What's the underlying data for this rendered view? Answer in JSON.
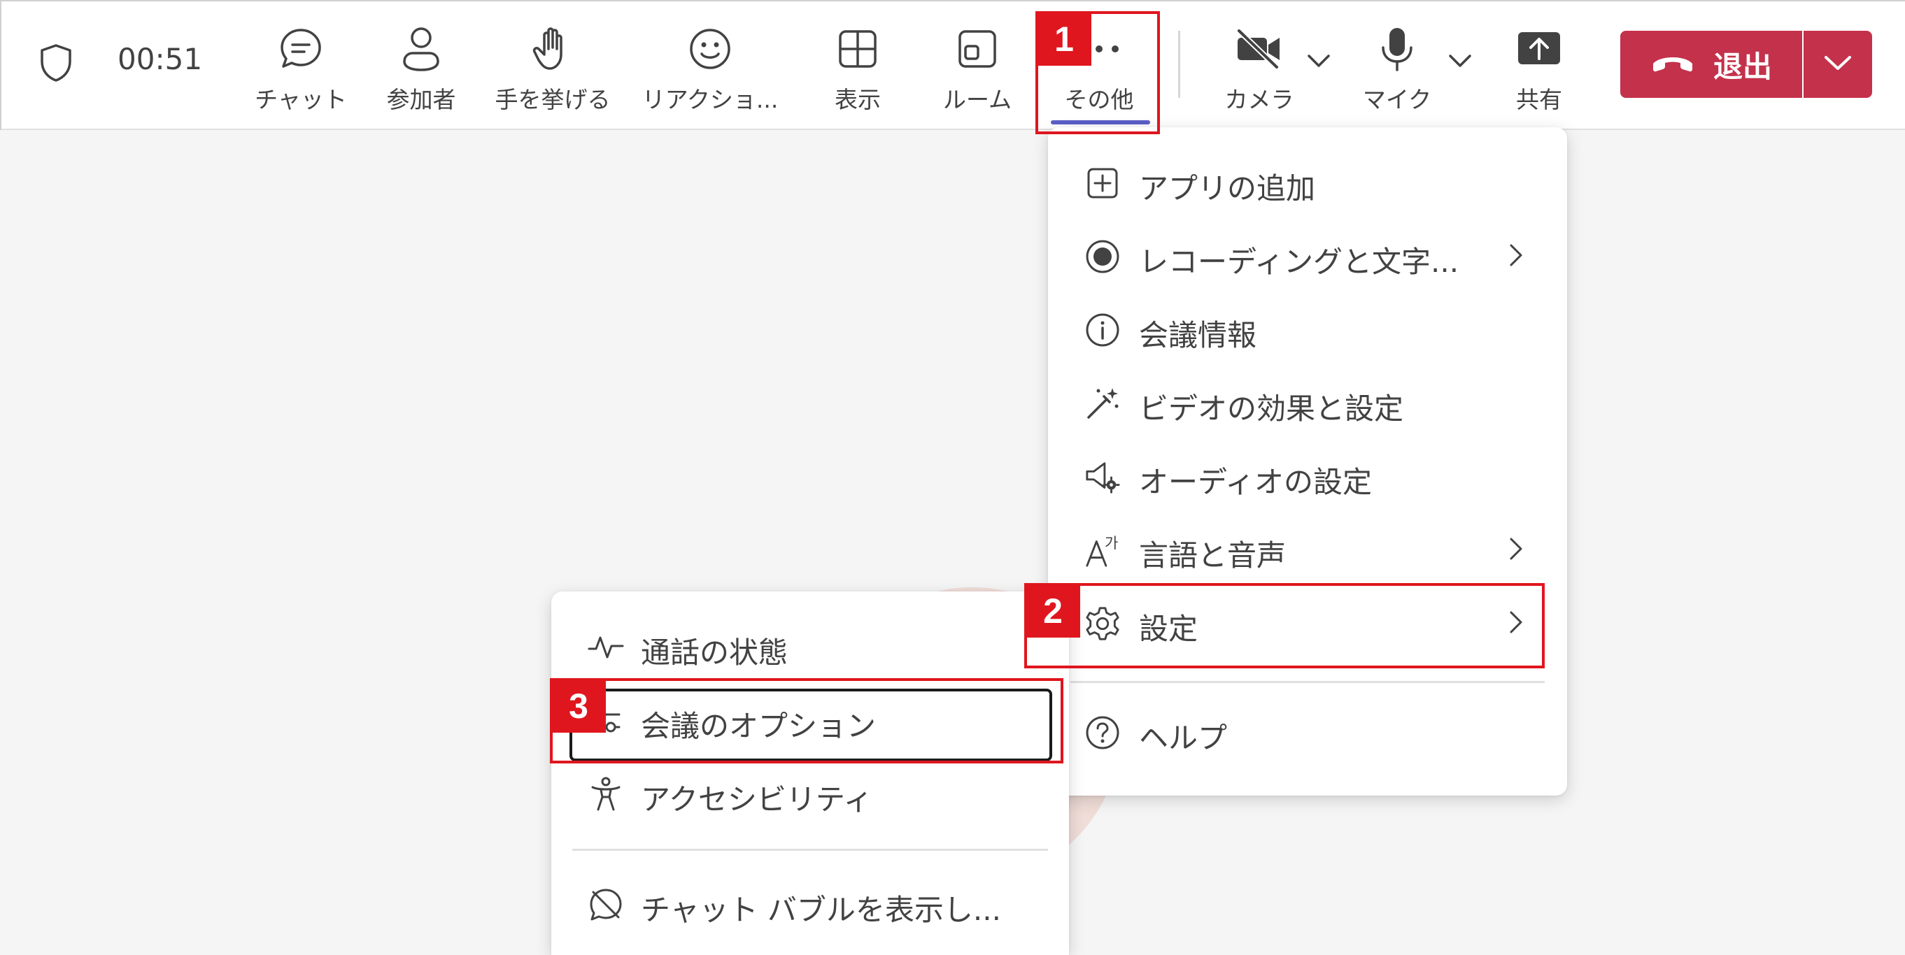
{
  "toolbar": {
    "timer": "00:51",
    "buttons": {
      "chat": "チャット",
      "participants": "参加者",
      "raise_hand": "手を挙げる",
      "reactions": "リアクショ...",
      "view": "表示",
      "rooms": "ルーム",
      "more": "その他",
      "camera": "カメラ",
      "mic": "マイク",
      "share": "共有"
    },
    "leave_label": "退出"
  },
  "more_menu": {
    "items": [
      {
        "label": "アプリの追加",
        "icon": "add-square-icon",
        "submenu": false
      },
      {
        "label": "レコーディングと文字...",
        "icon": "record-icon",
        "submenu": true
      },
      {
        "label": "会議情報",
        "icon": "info-icon",
        "submenu": false
      },
      {
        "label": "ビデオの効果と設定",
        "icon": "magic-wand-icon",
        "submenu": false
      },
      {
        "label": "オーディオの設定",
        "icon": "speaker-settings-icon",
        "submenu": false
      },
      {
        "label": "言語と音声",
        "icon": "language-icon",
        "submenu": true
      },
      {
        "label": "設定",
        "icon": "gear-icon",
        "submenu": true
      },
      {
        "label": "ヘルプ",
        "icon": "help-icon",
        "submenu": false
      }
    ]
  },
  "settings_submenu": {
    "items": [
      {
        "label": "通話の状態",
        "icon": "pulse-icon"
      },
      {
        "label": "会議のオプション",
        "icon": "options-icon"
      },
      {
        "label": "アクセシビリティ",
        "icon": "accessibility-icon"
      },
      {
        "label": "チャット バブルを表示し...",
        "icon": "chat-bubble-off-icon"
      }
    ]
  },
  "callouts": [
    "1",
    "2",
    "3"
  ],
  "colors": {
    "accent": "#5b5fc7",
    "leave": "#c4314b",
    "callout": "#e0161e"
  }
}
